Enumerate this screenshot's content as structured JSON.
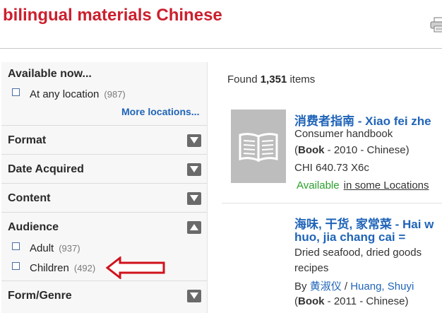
{
  "page": {
    "title": "bilingual materials Chinese"
  },
  "sidebar": {
    "available": {
      "title": "Available now...",
      "option": {
        "label": "At any location",
        "count": "(987)"
      },
      "more_link": "More locations..."
    },
    "format": {
      "title": "Format"
    },
    "date_acquired": {
      "title": "Date Acquired"
    },
    "content": {
      "title": "Content"
    },
    "audience": {
      "title": "Audience",
      "options": [
        {
          "label": "Adult",
          "count": "(937)"
        },
        {
          "label": "Children",
          "count": "(492)"
        }
      ]
    },
    "form_genre": {
      "title": "Form/Genre"
    }
  },
  "results": {
    "found_prefix": "Found",
    "found_count": "1,351",
    "found_suffix": "items",
    "items": [
      {
        "title": "消费者指南 - Xiao fei zhe",
        "subtitle": "Consumer handbook",
        "paren_open": "(",
        "format": "Book",
        "meta": " - 2010 - Chinese)",
        "call_number": "CHI 640.73 X6c",
        "availability": "Available",
        "location_link": "in some Locations"
      },
      {
        "title_line1": "海味, 干货, 家常菜 - Hai w",
        "title_line2": "huo, jia chang cai =",
        "subtitle_line1": "Dried seafood, dried goods",
        "subtitle_line2": "recipes",
        "by": "By",
        "author_cn": "黄淑仪",
        "author_sep": " / ",
        "author_en": "Huang, Shuyi",
        "paren_open": "(",
        "format": "Book",
        "meta": " - 2011 - Chinese)"
      }
    ]
  },
  "colors": {
    "title_red": "#cc1f2d",
    "link_blue": "#1f64b8",
    "available_green": "#2ca02c",
    "annotation_arrow": "#d0121b"
  },
  "icons": {
    "print": "printer-icon",
    "toggle_down": "triangle-down-icon",
    "toggle_up": "triangle-up-icon",
    "cover": "book-cover-placeholder-icon",
    "annotation": "red-arrow-icon"
  }
}
